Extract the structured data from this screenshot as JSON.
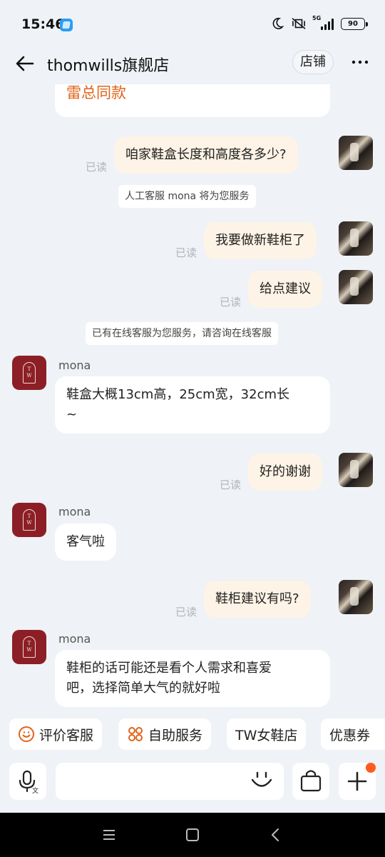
{
  "status": {
    "time": "15:46",
    "network": "5G",
    "battery": "90"
  },
  "header": {
    "title": "thomwills旗舰店",
    "shop_button": "店铺"
  },
  "chat": {
    "top_partial": "雷总同款",
    "messages": [
      {
        "text": "咱家鞋盒长度和高度各多少?",
        "read": "已读"
      },
      {
        "system": "人工客服 mona 将为您服务"
      },
      {
        "text": "我要做新鞋柜了",
        "read": "已读"
      },
      {
        "text": "给点建议",
        "read": "已读"
      },
      {
        "system": "已有在线客服为您服务，请咨询在线客服"
      },
      {
        "sender": "mona",
        "text_line1": "鞋盒大概13cm高，25cm宽，32cm长",
        "text_line2": "~"
      },
      {
        "text": "好的谢谢",
        "read": "已读"
      },
      {
        "sender": "mona",
        "text": "客气啦"
      },
      {
        "text": "鞋柜建议有吗?",
        "read": "已读"
      },
      {
        "sender": "mona",
        "text_line1": "鞋柜的话可能还是看个人需求和喜爱",
        "text_line2": "吧，选择简单大气的就好啦"
      }
    ],
    "shop_avatar_letters": "T W"
  },
  "quick_actions": [
    "评价客服",
    "自助服务",
    "TW女鞋店",
    "优惠券"
  ],
  "input": {
    "placeholder": ""
  },
  "colors": {
    "accent_orange": "#e0641a",
    "shop_avatar": "#8c1f26",
    "out_bubble": "#fdf3e6",
    "badge_dot": "#ff5a1f"
  }
}
